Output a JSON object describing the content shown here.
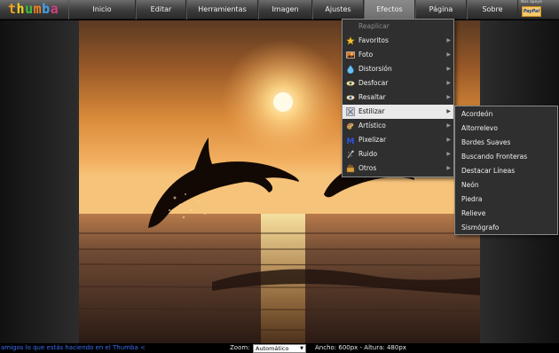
{
  "app": {
    "logo_letters": [
      "t",
      "h",
      "u",
      "m",
      "b",
      "a"
    ],
    "logo_colors": [
      "#f0a020",
      "#f0d020",
      "#40c040",
      "#f08020",
      "#40a0f0",
      "#d04080"
    ]
  },
  "menu": {
    "items": [
      {
        "label": "Inicio"
      },
      {
        "label": "Editar"
      },
      {
        "label": "Herramientas"
      },
      {
        "label": "Imagen"
      },
      {
        "label": "Ajustes"
      },
      {
        "label": "Efectos"
      },
      {
        "label": "Página"
      },
      {
        "label": "Sobre"
      }
    ],
    "active": "Efectos",
    "support_label": "Nos apoye",
    "paypal_label": "PayPal"
  },
  "effects_menu": {
    "items": [
      {
        "label": "Reaplicar",
        "icon": "none",
        "disabled": true,
        "submenu": false
      },
      {
        "label": "Favoritos",
        "icon": "star-icon",
        "submenu": true
      },
      {
        "label": "Foto",
        "icon": "photo-icon",
        "submenu": true
      },
      {
        "label": "Distorsión",
        "icon": "drop-icon",
        "submenu": true
      },
      {
        "label": "Desfocar",
        "icon": "eye-icon",
        "submenu": true
      },
      {
        "label": "Resaltar",
        "icon": "eye-icon",
        "submenu": true
      },
      {
        "label": "Estilizar",
        "icon": "stylize-icon",
        "submenu": true,
        "highlighted": true
      },
      {
        "label": "Artístico",
        "icon": "palette-icon",
        "submenu": true
      },
      {
        "label": "Pixelizar",
        "icon": "pixel-icon",
        "submenu": true
      },
      {
        "label": "Ruido",
        "icon": "noise-icon",
        "submenu": true
      },
      {
        "label": "Otros",
        "icon": "tools-icon",
        "submenu": true
      }
    ]
  },
  "stylize_submenu": {
    "items": [
      "Acordeón",
      "Altorrelevo",
      "Bordes Suaves",
      "Buscando Fronteras",
      "Destacar Líneas",
      "Neón",
      "Piedra",
      "Relieve",
      "Sismógrafo"
    ]
  },
  "statusbar": {
    "left_text": "amigos lo que estás haciendo en el Thumba <",
    "zoom_label": "Zoom:",
    "zoom_value": "Automático",
    "dimensions": "Ancho: 600px - Altura: 480px"
  },
  "colors": {
    "menu_text": "#f1f1f1",
    "status_link": "#3c6ff0",
    "highlight": "#e9e9e9"
  }
}
